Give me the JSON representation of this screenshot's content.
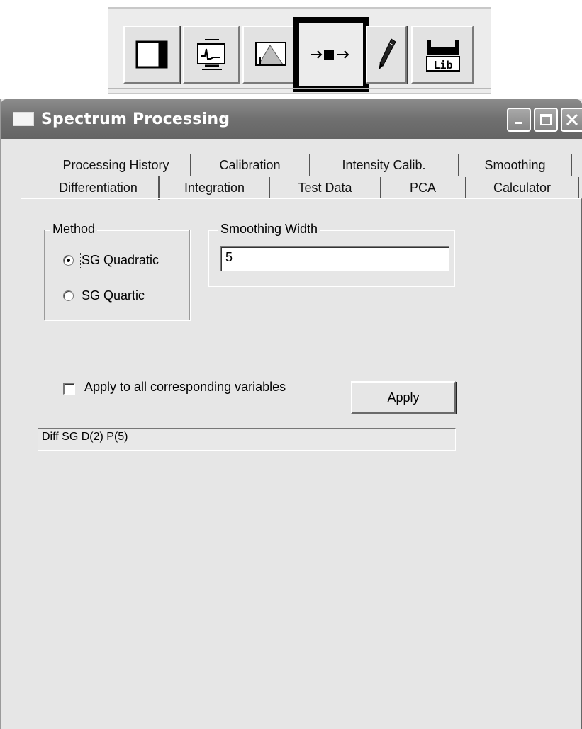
{
  "toolbar": {
    "buttons": [
      {
        "icon": "panel-layout-icon"
      },
      {
        "icon": "spectrum-display-icon"
      },
      {
        "icon": "peak-chart-icon"
      },
      {
        "icon": "process-arrow-icon",
        "selected": true
      },
      {
        "icon": "pen-tool-icon"
      },
      {
        "icon": "library-icon",
        "text": "Lib"
      }
    ]
  },
  "window": {
    "title": "Spectrum Processing",
    "controls": [
      "minimize-icon",
      "maximize-icon",
      "close-icon"
    ]
  },
  "tabs": {
    "back_row": [
      "Processing History",
      "Calibration",
      "Intensity Calib.",
      "Smoothing"
    ],
    "front_row": [
      "Differentiation",
      "Integration",
      "Test Data",
      "PCA",
      "Calculator"
    ],
    "selected": "Differentiation"
  },
  "method": {
    "label": "Method",
    "options": [
      "SG Quadratic",
      "SG Quartic"
    ],
    "selected": "SG Quadratic"
  },
  "smoothing_width": {
    "label": "Smoothing Width",
    "value": "5"
  },
  "apply_all": {
    "label": "Apply to all corresponding variables",
    "checked": false
  },
  "apply_button": "Apply",
  "status_text": "Diff SG D(2) P(5)"
}
